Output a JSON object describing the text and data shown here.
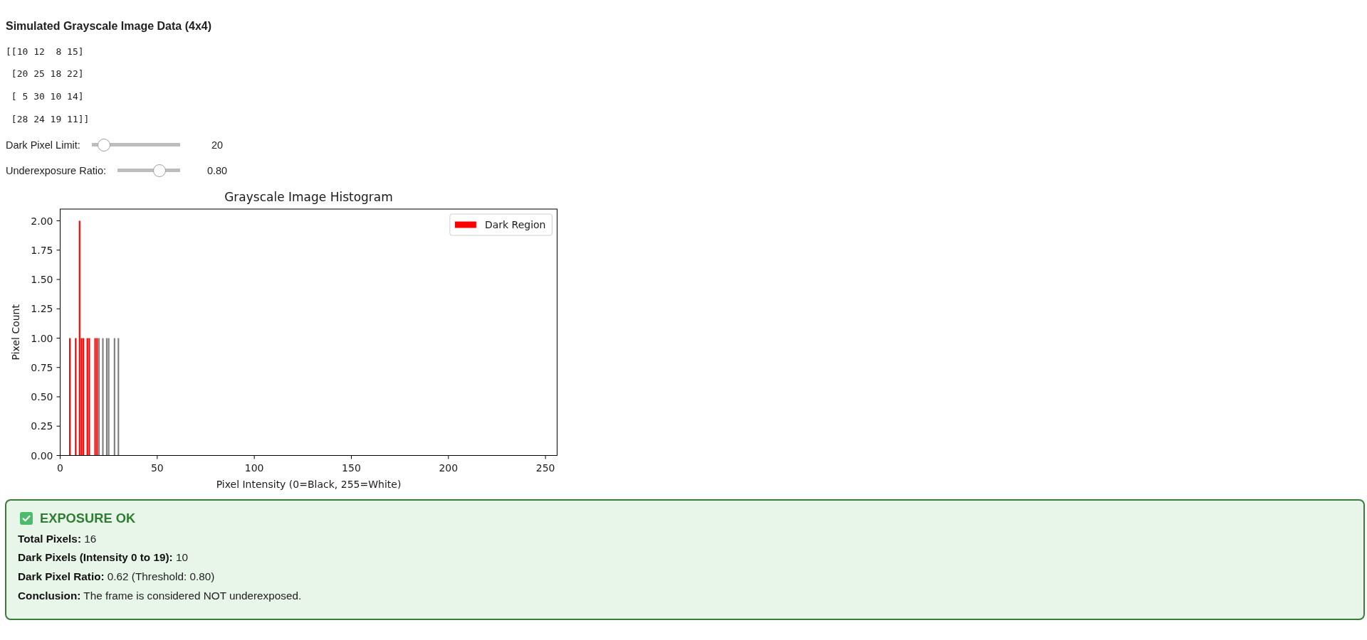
{
  "heading": "Simulated Grayscale Image Data (4x4)",
  "matrix_lines": [
    "[[10 12  8 15]",
    " [20 25 18 22]",
    " [ 5 30 10 14]",
    " [28 24 19 11]]"
  ],
  "sliders": [
    {
      "label": "Dark Pixel Limit:",
      "level": 0.08,
      "reading": "20"
    },
    {
      "label": "Underexposure Ratio:",
      "level": 0.72,
      "reading": "0.80"
    }
  ],
  "histogram": {
    "chart_data": {
      "type": "bar",
      "title": "Grayscale Image Histogram",
      "xlabel": "Pixel Intensity (0=Black, 255=White)",
      "ylabel": "Pixel Count",
      "x": [
        5,
        8,
        10,
        11,
        12,
        14,
        15,
        18,
        19,
        20,
        22,
        24,
        25,
        28,
        30
      ],
      "series": [
        {
          "name": "Dark Region",
          "color": "#ff0000",
          "values": [
            1,
            1,
            2,
            1,
            1,
            1,
            1,
            1,
            1,
            null,
            null,
            null,
            null,
            null,
            null
          ]
        },
        {
          "color": "#808080",
          "values": [
            null,
            null,
            null,
            null,
            null,
            null,
            null,
            null,
            null,
            1,
            1,
            1,
            1,
            1,
            1
          ]
        }
      ],
      "xlim": [
        0,
        256
      ],
      "ylim": [
        0,
        2.1
      ],
      "xticks": [
        0,
        50,
        100,
        150,
        200,
        250
      ],
      "yticks": [
        {
          "value": 0,
          "label": "0.00"
        },
        {
          "value": 0.25,
          "label": "0.25"
        },
        {
          "value": 0.5,
          "label": "0.50"
        },
        {
          "value": 0.75,
          "label": "0.75"
        },
        {
          "value": 1,
          "label": "1.00"
        },
        {
          "value": 1.25,
          "label": "1.25"
        },
        {
          "value": 1.5,
          "label": "1.50"
        },
        {
          "value": 1.75,
          "label": "1.75"
        },
        {
          "value": 2,
          "label": "2.00"
        }
      ]
    }
  },
  "result": {
    "passed": true,
    "title": "EXPOSURE OK",
    "lines": [
      {
        "label": "Total Pixels:",
        "value": "16"
      },
      {
        "label": "Dark Pixels (Intensity 0 to 19):",
        "value": "10"
      },
      {
        "label": "Dark Pixel Ratio:",
        "value": "0.62 (Threshold: 0.80)"
      },
      {
        "label": "Conclusion:",
        "value": "The frame is considered NOT underexposed."
      }
    ]
  }
}
